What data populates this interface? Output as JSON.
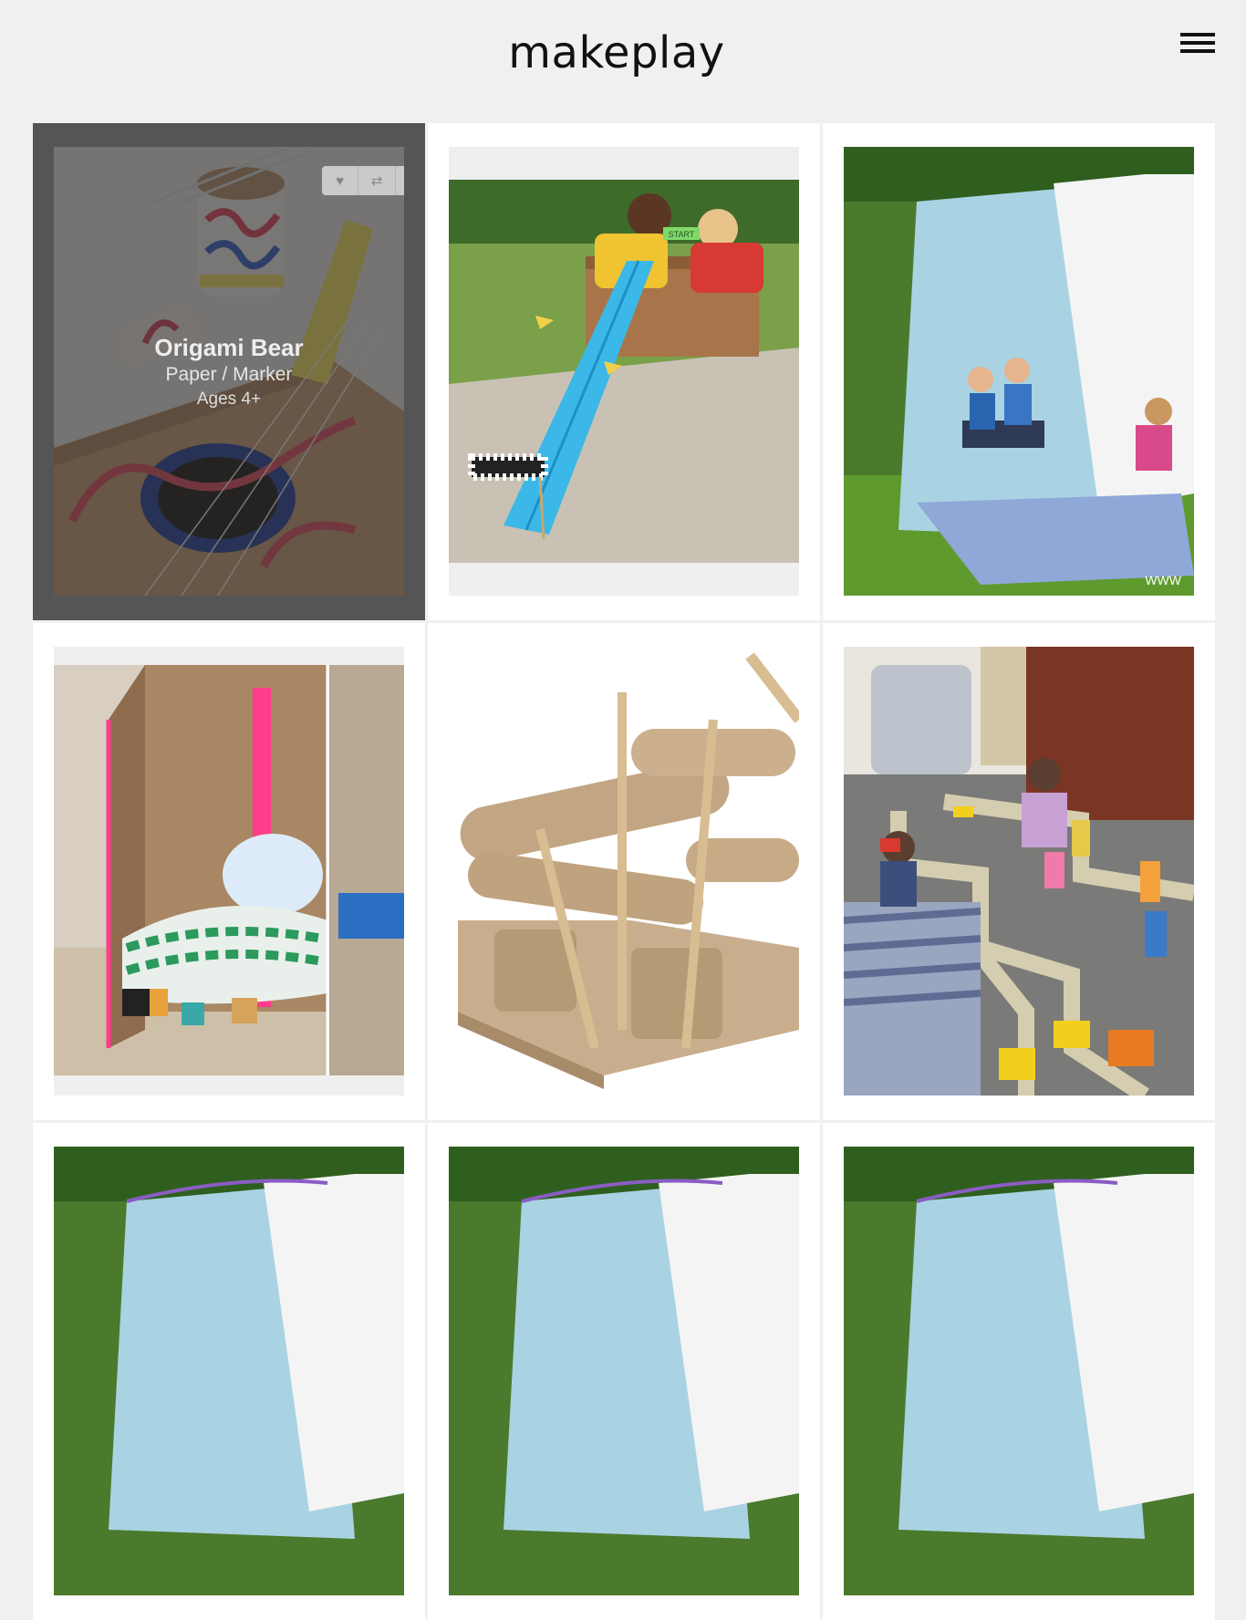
{
  "site": {
    "logo": "makeplay"
  },
  "header": {
    "menu_icon": "hamburger-menu-icon"
  },
  "featured": {
    "title": "Origami Bear",
    "materials": "Paper / Marker",
    "ages": "Ages 4+",
    "actions": [
      {
        "icon": "heart-icon",
        "glyph": "♥"
      },
      {
        "icon": "repost-icon",
        "glyph": "⇄"
      },
      {
        "icon": "share-icon",
        "glyph": "↗"
      }
    ]
  },
  "cards": [
    {
      "photo": "cardboard-guitar-photo"
    },
    {
      "photo": "foam-noodle-race-track-photo",
      "sign": "START"
    },
    {
      "photo": "hula-hoop-tent-photo",
      "watermark": "WWW"
    },
    {
      "photo": "cardboard-box-house-photo"
    },
    {
      "photo": "cardboard-tube-marble-run-photo"
    },
    {
      "photo": "tape-road-playmat-photo"
    },
    {
      "photo": "hula-hoop-tent-photo"
    },
    {
      "photo": "hula-hoop-tent-photo"
    },
    {
      "photo": "hula-hoop-tent-photo"
    }
  ],
  "colors": {
    "background": "#f0f0f0",
    "card": "#ffffff",
    "overlay": "#2d2d2d",
    "logo": "#111111"
  }
}
